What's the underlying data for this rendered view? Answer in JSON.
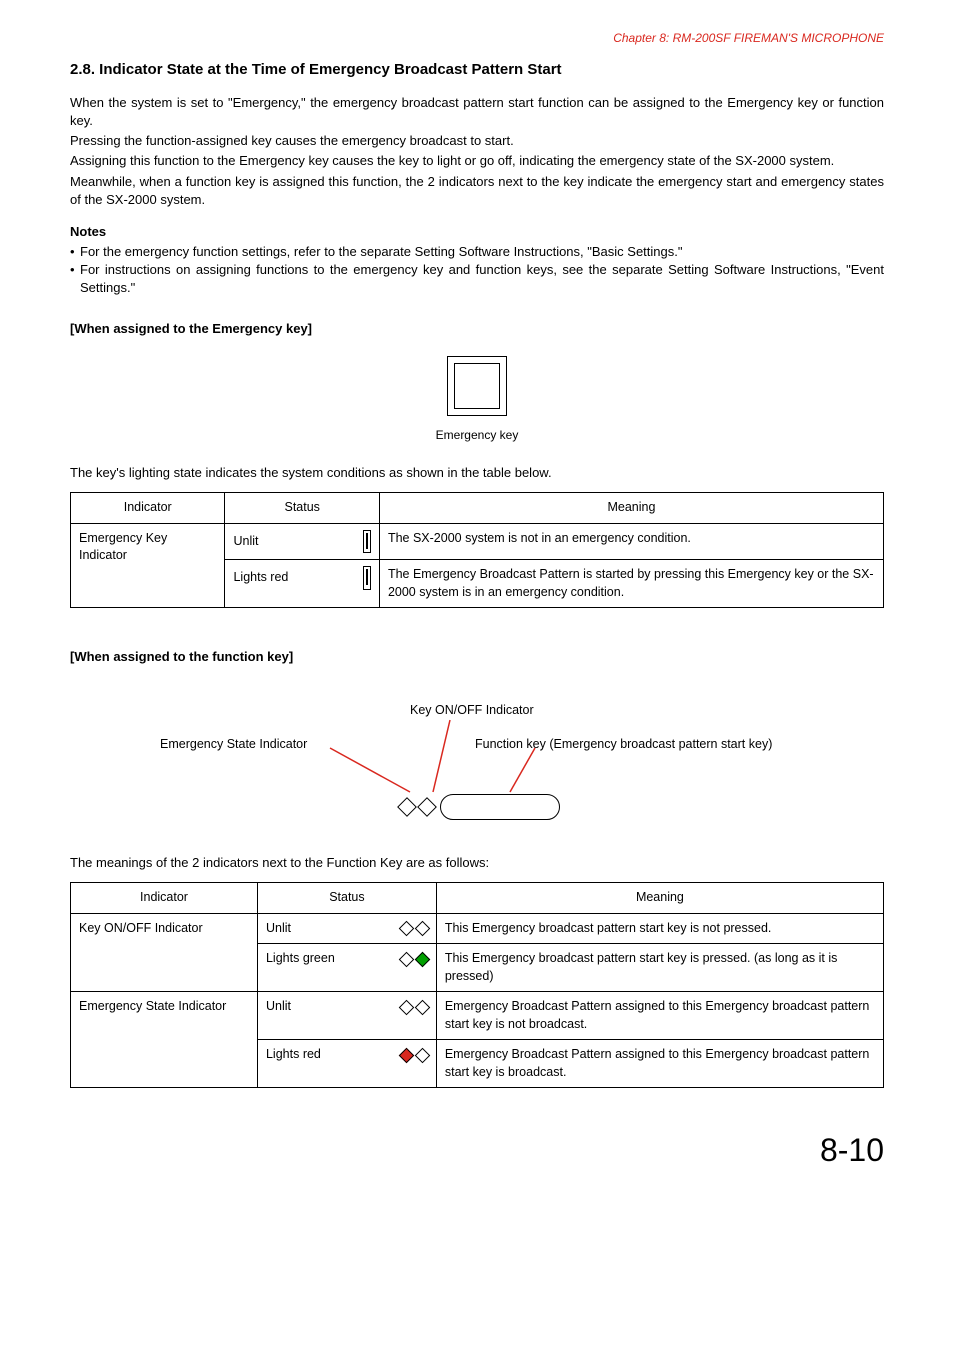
{
  "chapter_header": "Chapter 8: RM-200SF FIREMAN'S MICROPHONE",
  "section_title": "2.8. Indicator State at the Time of Emergency Broadcast Pattern Start",
  "paragraphs": {
    "p1": "When the system is set to \"Emergency,\" the emergency broadcast pattern start function can be assigned to the Emergency key or function key.",
    "p2": "Pressing the function-assigned key causes the emergency broadcast to start.",
    "p3": "Assigning this function to the Emergency key causes the key to light or go off, indicating the emergency state of the SX-2000 system.",
    "p4": "Meanwhile, when a function key is assigned this function, the 2 indicators next to the key indicate the emergency start and emergency states of the SX-2000 system."
  },
  "notes": {
    "title": "Notes",
    "items": [
      "For the emergency function settings, refer to the separate Setting Software Instructions, \"Basic Settings.\"",
      "For instructions on assigning functions to the emergency key and function keys, see the separate Setting Software Instructions, \"Event Settings.\""
    ]
  },
  "emk": {
    "subhead": "[When assigned to the Emergency key]",
    "caption": "Emergency key",
    "lead": "The key's lighting state indicates the system conditions as shown in the table below.",
    "table": {
      "headers": {
        "c1": "Indicator",
        "c2": "Status",
        "c3": "Meaning"
      },
      "indicator": "Emergency Key Indicator",
      "rows": [
        {
          "status": "Unlit",
          "icon_color": "white",
          "meaning": "The SX-2000 system is not in an emergency condition."
        },
        {
          "status": "Lights red",
          "icon_color": "red",
          "meaning": "The Emergency Broadcast Pattern is started by pressing this Emergency key or the SX-2000 system is in an emergency condition."
        }
      ]
    }
  },
  "fnk": {
    "subhead": "[When assigned to the function key]",
    "labels": {
      "onoff": "Key ON/OFF Indicator",
      "emstate": "Emergency State Indicator",
      "fnkey": "Function key (Emergency broadcast pattern start key)"
    },
    "lead": "The meanings of the 2 indicators next to the Function Key are as follows:",
    "table": {
      "headers": {
        "c1": "Indicator",
        "c2": "Status",
        "c3": "Meaning"
      },
      "groups": [
        {
          "indicator": "Key ON/OFF Indicator",
          "rows": [
            {
              "status": "Unlit",
              "led1": "white",
              "led2": "white",
              "meaning": "This Emergency broadcast pattern start key is not pressed."
            },
            {
              "status": "Lights green",
              "led1": "white",
              "led2": "green",
              "meaning": "This Emergency broadcast pattern start key is pressed. (as long as it is pressed)"
            }
          ]
        },
        {
          "indicator": "Emergency State Indicator",
          "rows": [
            {
              "status": "Unlit",
              "led1": "white",
              "led2": "white",
              "meaning": "Emergency Broadcast Pattern assigned to this Emergency broadcast pattern start key is not broadcast."
            },
            {
              "status": "Lights red",
              "led1": "red",
              "led2": "white",
              "meaning": "Emergency Broadcast Pattern assigned to this Emergency broadcast pattern start key is broadcast."
            }
          ]
        }
      ]
    }
  },
  "page_number": "8-10"
}
